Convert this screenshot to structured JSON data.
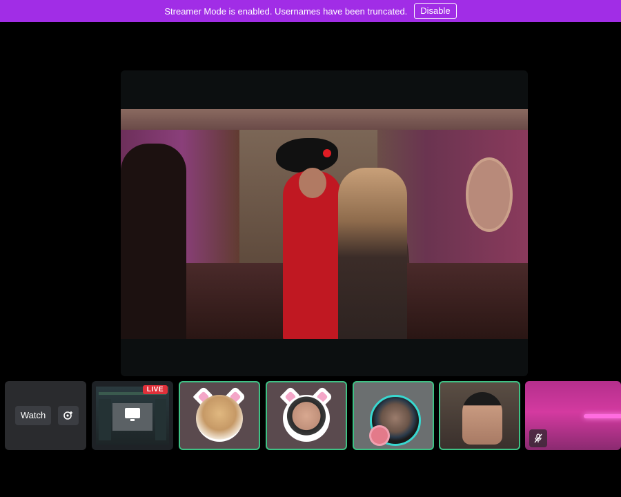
{
  "banner": {
    "message": "Streamer Mode is enabled. Usernames have been truncated.",
    "disable_label": "Disable",
    "color": "#a12de6"
  },
  "stage": {
    "background": "#0c0f10"
  },
  "participants": {
    "watch_label": "Watch",
    "live_badge": "LIVE",
    "speaking_ring_color": "#3ec285",
    "icons": [
      "add-stream-icon",
      "monitor-icon",
      "mic-muted-icon"
    ]
  }
}
